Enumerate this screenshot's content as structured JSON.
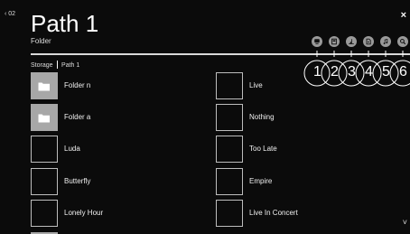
{
  "header": {
    "back_label": "‹ 02",
    "title": "Path 1",
    "subtitle": "Folder",
    "close_glyph": "×"
  },
  "toolbar": {
    "icons": [
      {
        "name": "tv-icon"
      },
      {
        "name": "photo-icon"
      },
      {
        "name": "music-list-icon"
      },
      {
        "name": "file-icon"
      },
      {
        "name": "music-note-icon"
      },
      {
        "name": "search-icon"
      }
    ],
    "callout_numbers": [
      "1",
      "2",
      "3",
      "4",
      "5",
      "6"
    ]
  },
  "breadcrumb": {
    "root": "Storage",
    "current": "Path 1"
  },
  "items": [
    {
      "label": "Folder n",
      "type": "folder"
    },
    {
      "label": "Live",
      "type": "file"
    },
    {
      "label": "Folder a",
      "type": "folder"
    },
    {
      "label": "Nothing",
      "type": "file"
    },
    {
      "label": "Luda",
      "type": "file"
    },
    {
      "label": "Too Late",
      "type": "file"
    },
    {
      "label": "Butterfly",
      "type": "file"
    },
    {
      "label": "Empire",
      "type": "file"
    },
    {
      "label": "Lonely Hour",
      "type": "file"
    },
    {
      "label": "Live In Concert",
      "type": "file"
    }
  ],
  "scroll_down_glyph": "˅"
}
